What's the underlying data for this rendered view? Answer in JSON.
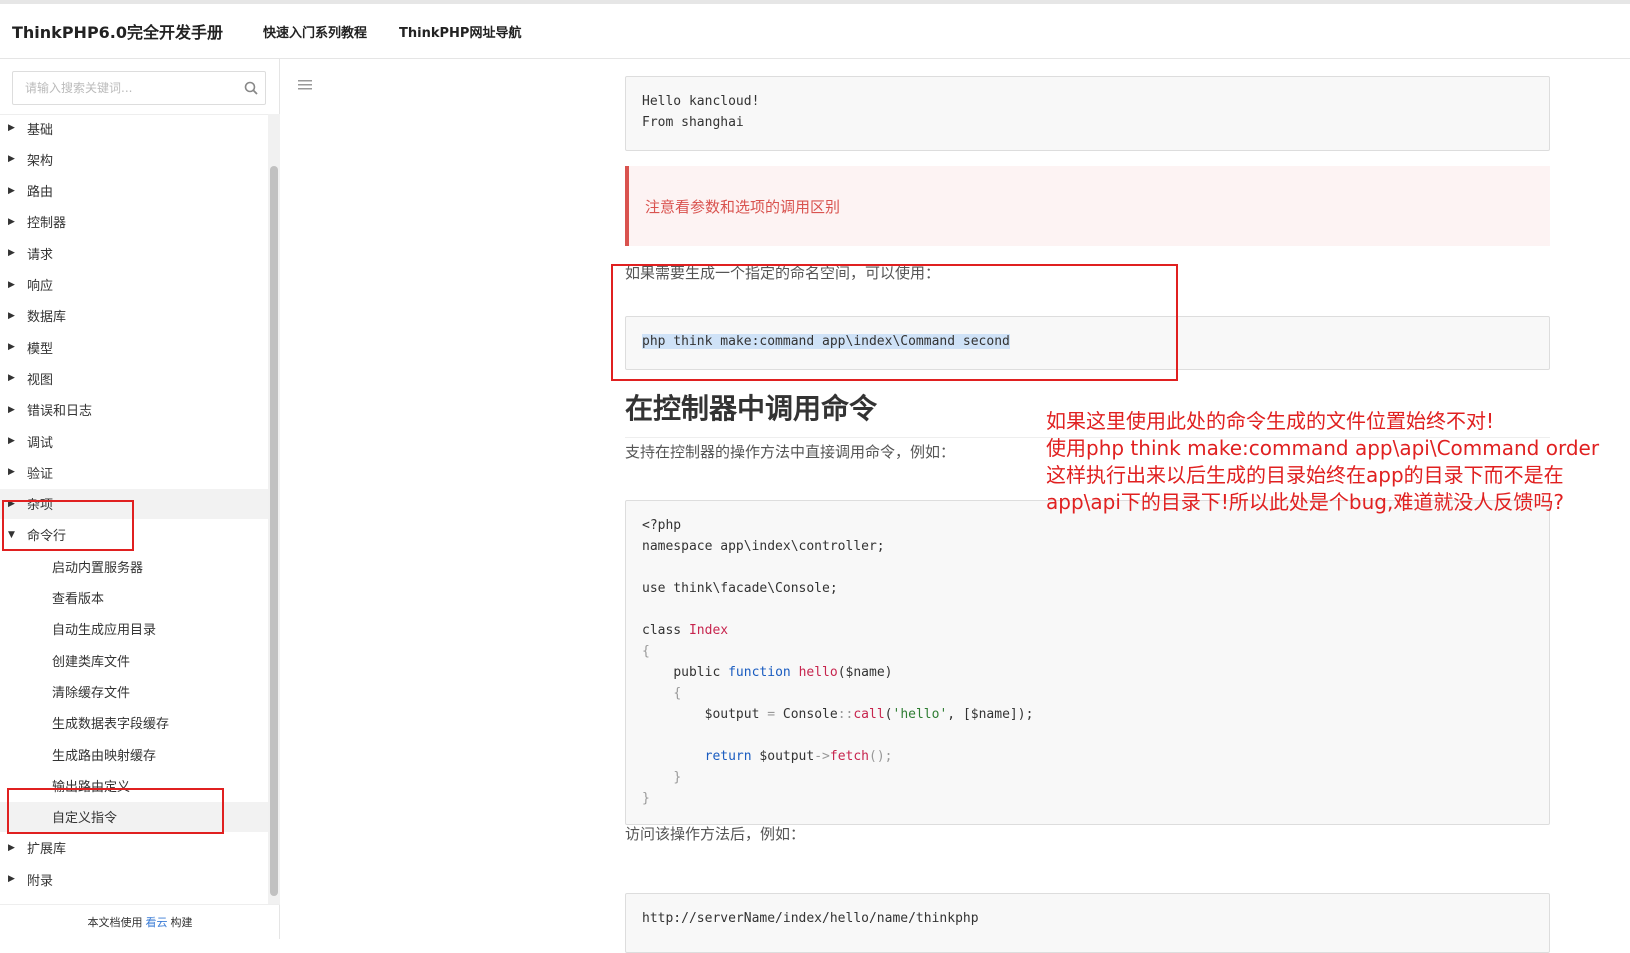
{
  "header": {
    "brand": "ThinkPHP6.0完全开发手册",
    "nav": [
      "快速入门系列教程",
      "ThinkPHP网址导航"
    ]
  },
  "sidebar": {
    "search_placeholder": "请输入搜索关键词...",
    "items": [
      {
        "label": "基础",
        "type": "collapsed"
      },
      {
        "label": "架构",
        "type": "collapsed"
      },
      {
        "label": "路由",
        "type": "collapsed"
      },
      {
        "label": "控制器",
        "type": "collapsed"
      },
      {
        "label": "请求",
        "type": "collapsed"
      },
      {
        "label": "响应",
        "type": "collapsed"
      },
      {
        "label": "数据库",
        "type": "collapsed"
      },
      {
        "label": "模型",
        "type": "collapsed"
      },
      {
        "label": "视图",
        "type": "collapsed"
      },
      {
        "label": "错误和日志",
        "type": "collapsed"
      },
      {
        "label": "调试",
        "type": "collapsed"
      },
      {
        "label": "验证",
        "type": "collapsed"
      },
      {
        "label": "杂项",
        "type": "collapsed"
      },
      {
        "label": "命令行",
        "type": "expanded"
      },
      {
        "label": "启动内置服务器",
        "type": "child"
      },
      {
        "label": "查看版本",
        "type": "child"
      },
      {
        "label": "自动生成应用目录",
        "type": "child"
      },
      {
        "label": "创建类库文件",
        "type": "child"
      },
      {
        "label": "清除缓存文件",
        "type": "child"
      },
      {
        "label": "生成数据表字段缓存",
        "type": "child"
      },
      {
        "label": "生成路由映射缓存",
        "type": "child"
      },
      {
        "label": "输出路由定义",
        "type": "child"
      },
      {
        "label": "自定义指令",
        "type": "child-active"
      },
      {
        "label": "扩展库",
        "type": "collapsed"
      },
      {
        "label": "附录",
        "type": "collapsed"
      }
    ],
    "footer": {
      "prefix": "本文档使用",
      "link": "看云",
      "suffix": "构建"
    }
  },
  "content": {
    "code_output": [
      "Hello kancloud!",
      "From shanghai"
    ],
    "notice": "注意看参数和选项的调用区别",
    "para_namespace": "如果需要生成一个指定的命名空间，可以使用：",
    "code_namespace": "php think make:command app\\index\\Command second",
    "heading": "在控制器中调用命令",
    "para_controller": "支持在控制器的操作方法中直接调用命令，例如：",
    "code_controller": {
      "l1": "<?php",
      "l2": "namespace app\\index\\controller;",
      "l3": "use think\\facade\\Console;",
      "l4_kw": "class",
      "l4_name": "Index",
      "l5": "{",
      "l6_kw1": "public",
      "l6_kw2": "function",
      "l6_fn": "hello",
      "l6_arg": "($name)",
      "l7": "{",
      "l8_var": "$output",
      "l8_cls": "Console",
      "l8_call": "call",
      "l8_str": "'hello'",
      "l8_rest": "[$name]);",
      "l9_kw": "return",
      "l9_var": "$output",
      "l9_call": "fetch",
      "l10": "}",
      "l11": "}"
    },
    "para_visit": "访问该操作方法后，例如：",
    "code_url": "http://serverName/index/hello/name/thinkphp"
  },
  "annotation": {
    "lines": [
      "如果这里使用此处的命令生成的文件位置始终不对!",
      "使用php think make:command app\\api\\Command order",
      "这样执行出来以后生成的目录始终在app的目录下而不是在",
      "app\\api下的目录下!所以此处是个bug,难道就没人反馈吗?"
    ],
    "color": "#e02020"
  }
}
